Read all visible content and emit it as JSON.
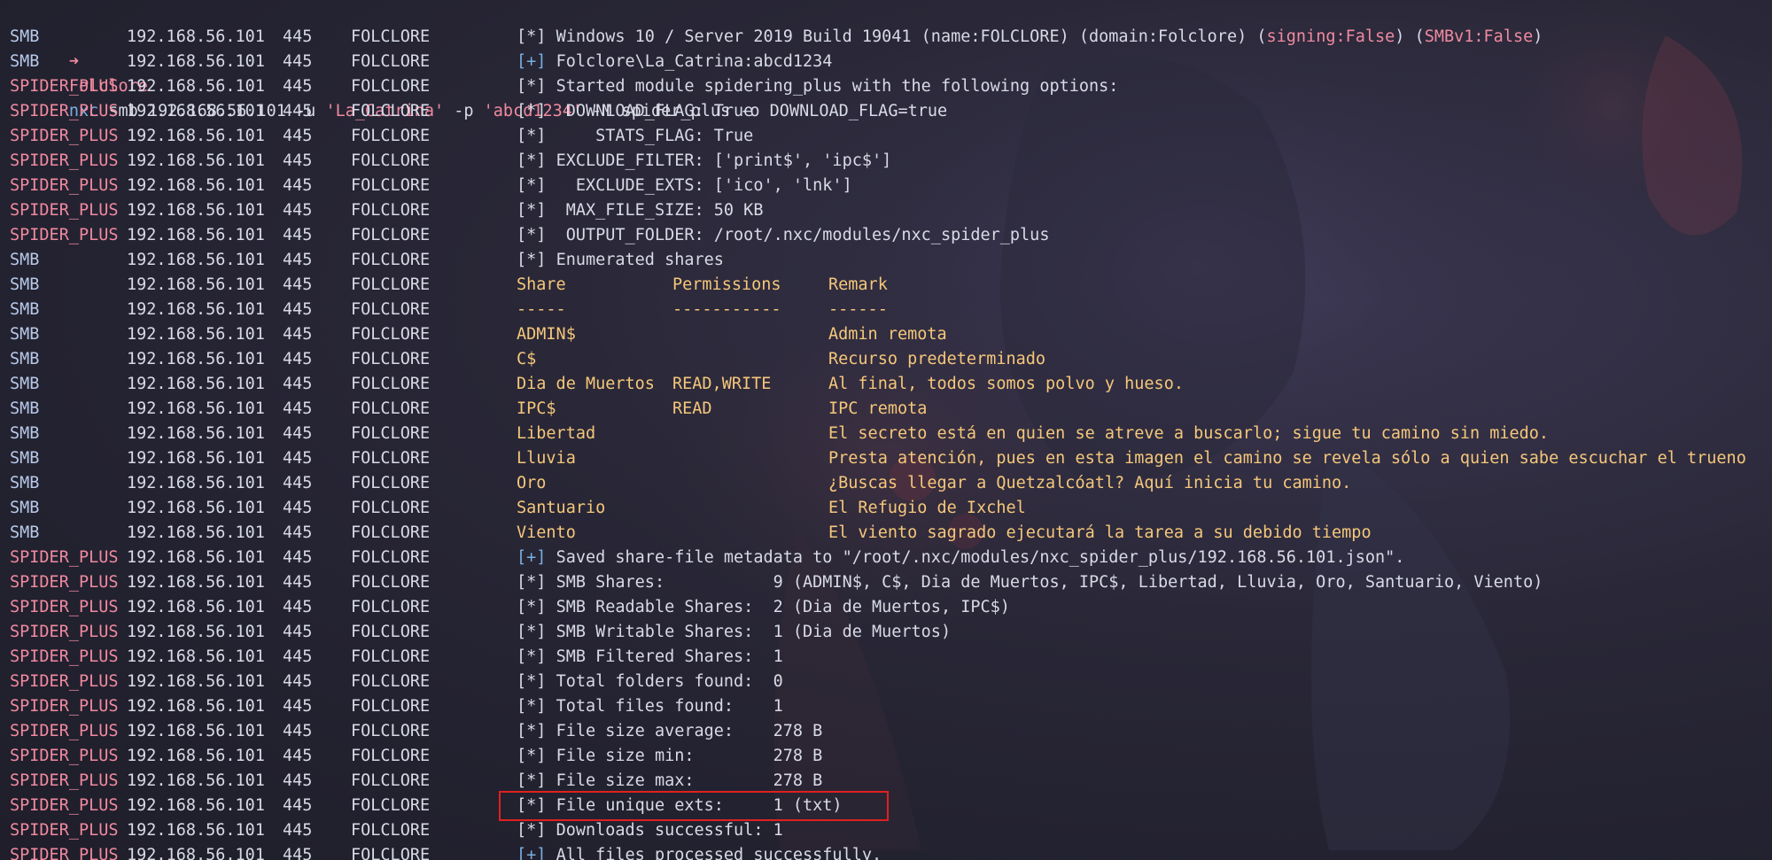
{
  "prompt": {
    "arrow": "➜",
    "dir": "Folclore",
    "cmd": "nxc",
    "args_pre": "smb 192.168.56.101 -u ",
    "user": "'La_Catrina'",
    "args_mid": " -p ",
    "password": "'abcd1234'",
    "args_post": " -M spider_plus -o DOWNLOAD_FLAG=true"
  },
  "colors": {
    "smb_proto": "#b8c8e8",
    "spider_proto": "#f08aa0",
    "share_text": "#f5c77a",
    "plus_tag": "#7ab0e0",
    "highlight_border": "#e02020"
  },
  "lines": [
    {
      "proto": "SMB",
      "ip": "192.168.56.101",
      "port": "445",
      "host": "FOLCLORE",
      "tag": "[*]",
      "msg": "Windows 10 / Server 2019 Build 19041 (name:FOLCLORE) (domain:Folclore) (",
      "hl1": "signing:False",
      "msg2": ") (",
      "hl2": "SMBv1:False",
      "msg3": ")"
    },
    {
      "proto": "SMB",
      "ip": "192.168.56.101",
      "port": "445",
      "host": "FOLCLORE",
      "tag": "[+]",
      "msg": "Folclore\\La_Catrina:abcd1234"
    },
    {
      "proto": "SPIDER_PLUS",
      "ip": "192.168.56.101",
      "port": "445",
      "host": "FOLCLORE",
      "tag": "[*]",
      "msg": "Started module spidering_plus with the following options:"
    },
    {
      "proto": "SPIDER_PLUS",
      "ip": "192.168.56.101",
      "port": "445",
      "host": "FOLCLORE",
      "tag": "[*]",
      "msg": " DOWNLOAD_FLAG: True"
    },
    {
      "proto": "SPIDER_PLUS",
      "ip": "192.168.56.101",
      "port": "445",
      "host": "FOLCLORE",
      "tag": "[*]",
      "msg": "    STATS_FLAG: True"
    },
    {
      "proto": "SPIDER_PLUS",
      "ip": "192.168.56.101",
      "port": "445",
      "host": "FOLCLORE",
      "tag": "[*]",
      "msg": "EXCLUDE_FILTER: ['print$', 'ipc$']"
    },
    {
      "proto": "SPIDER_PLUS",
      "ip": "192.168.56.101",
      "port": "445",
      "host": "FOLCLORE",
      "tag": "[*]",
      "msg": "  EXCLUDE_EXTS: ['ico', 'lnk']"
    },
    {
      "proto": "SPIDER_PLUS",
      "ip": "192.168.56.101",
      "port": "445",
      "host": "FOLCLORE",
      "tag": "[*]",
      "msg": " MAX_FILE_SIZE: 50 KB"
    },
    {
      "proto": "SPIDER_PLUS",
      "ip": "192.168.56.101",
      "port": "445",
      "host": "FOLCLORE",
      "tag": "[*]",
      "msg": " OUTPUT_FOLDER: /root/.nxc/modules/nxc_spider_plus"
    },
    {
      "proto": "SMB",
      "ip": "192.168.56.101",
      "port": "445",
      "host": "FOLCLORE",
      "tag": "[*]",
      "msg": "Enumerated shares"
    }
  ],
  "shares_header": {
    "share": "Share",
    "perm": "Permissions",
    "remark": "Remark"
  },
  "shares_sep": {
    "share": "-----",
    "perm": "-----------",
    "remark": "------"
  },
  "shares": [
    {
      "share": "ADMIN$",
      "perm": "",
      "remark": "Admin remota"
    },
    {
      "share": "C$",
      "perm": "",
      "remark": "Recurso predeterminado"
    },
    {
      "share": "Dia de Muertos",
      "perm": "READ,WRITE",
      "remark": "Al final, todos somos polvo y hueso."
    },
    {
      "share": "IPC$",
      "perm": "READ",
      "remark": "IPC remota"
    },
    {
      "share": "Libertad",
      "perm": "",
      "remark": "El secreto está en quien se atreve a buscarlo; sigue tu camino sin miedo."
    },
    {
      "share": "Lluvia",
      "perm": "",
      "remark": "Presta atención, pues en esta imagen el camino se revela sólo a quien sabe escuchar el trueno"
    },
    {
      "share": "Oro",
      "perm": "",
      "remark": "¿Buscas llegar a Quetzalcóatl? Aquí inicia tu camino."
    },
    {
      "share": "Santuario",
      "perm": "",
      "remark": "El Refugio de Ixchel"
    },
    {
      "share": "Viento",
      "perm": "",
      "remark": "El viento sagrado ejecutará la tarea a su debido tiempo"
    }
  ],
  "share_row_meta": {
    "proto": "SMB",
    "ip": "192.168.56.101",
    "port": "445",
    "host": "FOLCLORE"
  },
  "summary": [
    {
      "proto": "SPIDER_PLUS",
      "ip": "192.168.56.101",
      "port": "445",
      "host": "FOLCLORE",
      "tag": "[+]",
      "msg": "Saved share-file metadata to \"/root/.nxc/modules/nxc_spider_plus/192.168.56.101.json\"."
    },
    {
      "proto": "SPIDER_PLUS",
      "ip": "192.168.56.101",
      "port": "445",
      "host": "FOLCLORE",
      "tag": "[*]",
      "msg": "SMB Shares:           9 (ADMIN$, C$, Dia de Muertos, IPC$, Libertad, Lluvia, Oro, Santuario, Viento)"
    },
    {
      "proto": "SPIDER_PLUS",
      "ip": "192.168.56.101",
      "port": "445",
      "host": "FOLCLORE",
      "tag": "[*]",
      "msg": "SMB Readable Shares:  2 (Dia de Muertos, IPC$)"
    },
    {
      "proto": "SPIDER_PLUS",
      "ip": "192.168.56.101",
      "port": "445",
      "host": "FOLCLORE",
      "tag": "[*]",
      "msg": "SMB Writable Shares:  1 (Dia de Muertos)"
    },
    {
      "proto": "SPIDER_PLUS",
      "ip": "192.168.56.101",
      "port": "445",
      "host": "FOLCLORE",
      "tag": "[*]",
      "msg": "SMB Filtered Shares:  1"
    },
    {
      "proto": "SPIDER_PLUS",
      "ip": "192.168.56.101",
      "port": "445",
      "host": "FOLCLORE",
      "tag": "[*]",
      "msg": "Total folders found:  0"
    },
    {
      "proto": "SPIDER_PLUS",
      "ip": "192.168.56.101",
      "port": "445",
      "host": "FOLCLORE",
      "tag": "[*]",
      "msg": "Total files found:    1"
    },
    {
      "proto": "SPIDER_PLUS",
      "ip": "192.168.56.101",
      "port": "445",
      "host": "FOLCLORE",
      "tag": "[*]",
      "msg": "File size average:    278 B"
    },
    {
      "proto": "SPIDER_PLUS",
      "ip": "192.168.56.101",
      "port": "445",
      "host": "FOLCLORE",
      "tag": "[*]",
      "msg": "File size min:        278 B"
    },
    {
      "proto": "SPIDER_PLUS",
      "ip": "192.168.56.101",
      "port": "445",
      "host": "FOLCLORE",
      "tag": "[*]",
      "msg": "File size max:        278 B"
    },
    {
      "proto": "SPIDER_PLUS",
      "ip": "192.168.56.101",
      "port": "445",
      "host": "FOLCLORE",
      "tag": "[*]",
      "msg": "File unique exts:     1 (txt)"
    },
    {
      "proto": "SPIDER_PLUS",
      "ip": "192.168.56.101",
      "port": "445",
      "host": "FOLCLORE",
      "tag": "[*]",
      "msg": "Downloads successful: 1"
    },
    {
      "proto": "SPIDER_PLUS",
      "ip": "192.168.56.101",
      "port": "445",
      "host": "FOLCLORE",
      "tag": "[+]",
      "msg": "All files processed successfully."
    }
  ]
}
